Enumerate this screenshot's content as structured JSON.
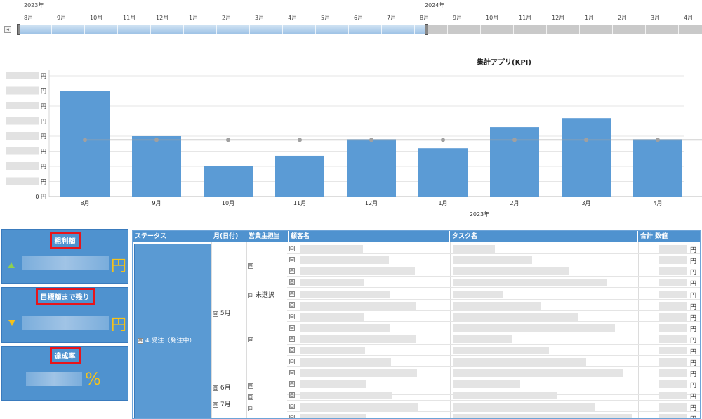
{
  "timeline": {
    "years": [
      "2023年",
      "2024年"
    ],
    "months_2023": [
      "8月",
      "9月",
      "10月",
      "11月",
      "12月",
      "1月",
      "2月",
      "3月",
      "4月",
      "5月",
      "6月",
      "7月"
    ],
    "months_2024": [
      "8月",
      "9月",
      "10月",
      "11月",
      "12月",
      "1月",
      "2月",
      "3月",
      "4月"
    ],
    "scroll_left_glyph": "◂"
  },
  "chart_data": {
    "type": "bar",
    "title": "集計アプリ(KPI)",
    "categories": [
      "8月",
      "9月",
      "10月",
      "11月",
      "12月",
      "1月",
      "2月",
      "3月",
      "4月"
    ],
    "values": [
      7.0,
      4.0,
      2.0,
      2.7,
      3.8,
      3.2,
      4.6,
      5.2,
      3.8
    ],
    "target_line": 3.75,
    "xlabel": "2023年",
    "ylabel_unit": "円",
    "y_tick_unit_labels": [
      "円",
      "円",
      "円",
      "円",
      "円",
      "円",
      "円",
      "円"
    ],
    "y_zero_label": "0 円",
    "ylim": [
      0,
      8
    ],
    "grid": true,
    "bar_color": "#5b9bd5",
    "line_color": "#a0a0a0"
  },
  "cards": [
    {
      "label": "粗利額",
      "unit": "円",
      "trend": "up"
    },
    {
      "label": "目標額まで残り",
      "unit": "円",
      "trend": "down"
    },
    {
      "label": "達成率",
      "unit": "%",
      "trend": "none"
    }
  ],
  "table": {
    "headers": [
      "ステータス",
      "月(日付)",
      "営業主担当",
      "顧客名",
      "タスク名",
      "合計 数値"
    ],
    "status": "4.受注（発注中）",
    "month_groups": [
      "5月",
      "6月",
      "7月"
    ],
    "staff_label": "未選択",
    "amount_unit": "円",
    "expand_glyph": "⊟"
  },
  "colors": {
    "accent_blue": "#4f92cf",
    "highlight_red": "#e8141a",
    "kpi_yellow": "#f6c21a",
    "up_green": "#8fd14f"
  }
}
